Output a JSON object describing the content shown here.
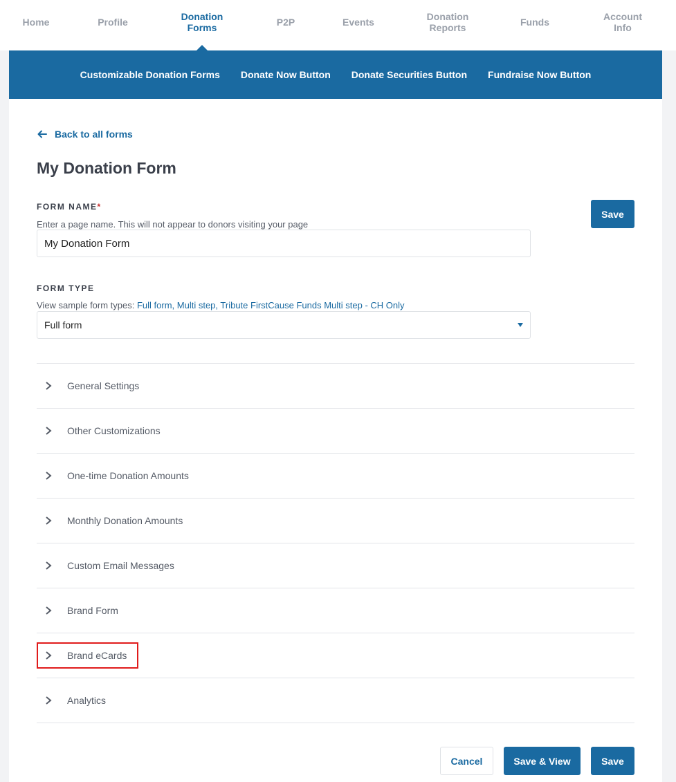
{
  "top_nav": {
    "items": [
      {
        "label": "Home"
      },
      {
        "label": "Profile"
      },
      {
        "label": "Donation\nForms"
      },
      {
        "label": "P2P"
      },
      {
        "label": "Events"
      },
      {
        "label": "Donation\nReports"
      },
      {
        "label": "Funds"
      },
      {
        "label": "Account\nInfo"
      }
    ],
    "active_index": 2
  },
  "sub_nav": {
    "items": [
      {
        "label": "Customizable Donation Forms"
      },
      {
        "label": "Donate Now Button"
      },
      {
        "label": "Donate Securities Button"
      },
      {
        "label": "Fundraise Now Button"
      }
    ]
  },
  "back_link": {
    "label": "Back to all forms",
    "icon": "arrow-left-icon"
  },
  "page_title": "My Donation Form",
  "form_name": {
    "label": "FORM NAME",
    "required_mark": "*",
    "help": "Enter a page name. This will not appear to donors visiting your page",
    "value": "My Donation Form"
  },
  "form_type": {
    "label": "FORM TYPE",
    "help_prefix": "View sample form types: ",
    "sample_links": {
      "full_form": "Full form,",
      "multi_step": "Multi step,",
      "tribute": "Tribute FirstCause Funds Multi step - CH Only"
    },
    "selected": "Full form"
  },
  "accordion": {
    "items": [
      {
        "label": "General Settings"
      },
      {
        "label": "Other Customizations"
      },
      {
        "label": "One-time Donation Amounts"
      },
      {
        "label": "Monthly Donation Amounts"
      },
      {
        "label": "Custom Email Messages"
      },
      {
        "label": "Brand Form"
      },
      {
        "label": "Brand eCards"
      },
      {
        "label": "Analytics"
      }
    ],
    "highlighted": "Brand eCards"
  },
  "buttons": {
    "save_top": "Save",
    "cancel": "Cancel",
    "save_view": "Save & View",
    "save_bottom": "Save"
  },
  "colors": {
    "brand_blue": "#1a6aa1",
    "highlight_red": "#e01b1b"
  }
}
